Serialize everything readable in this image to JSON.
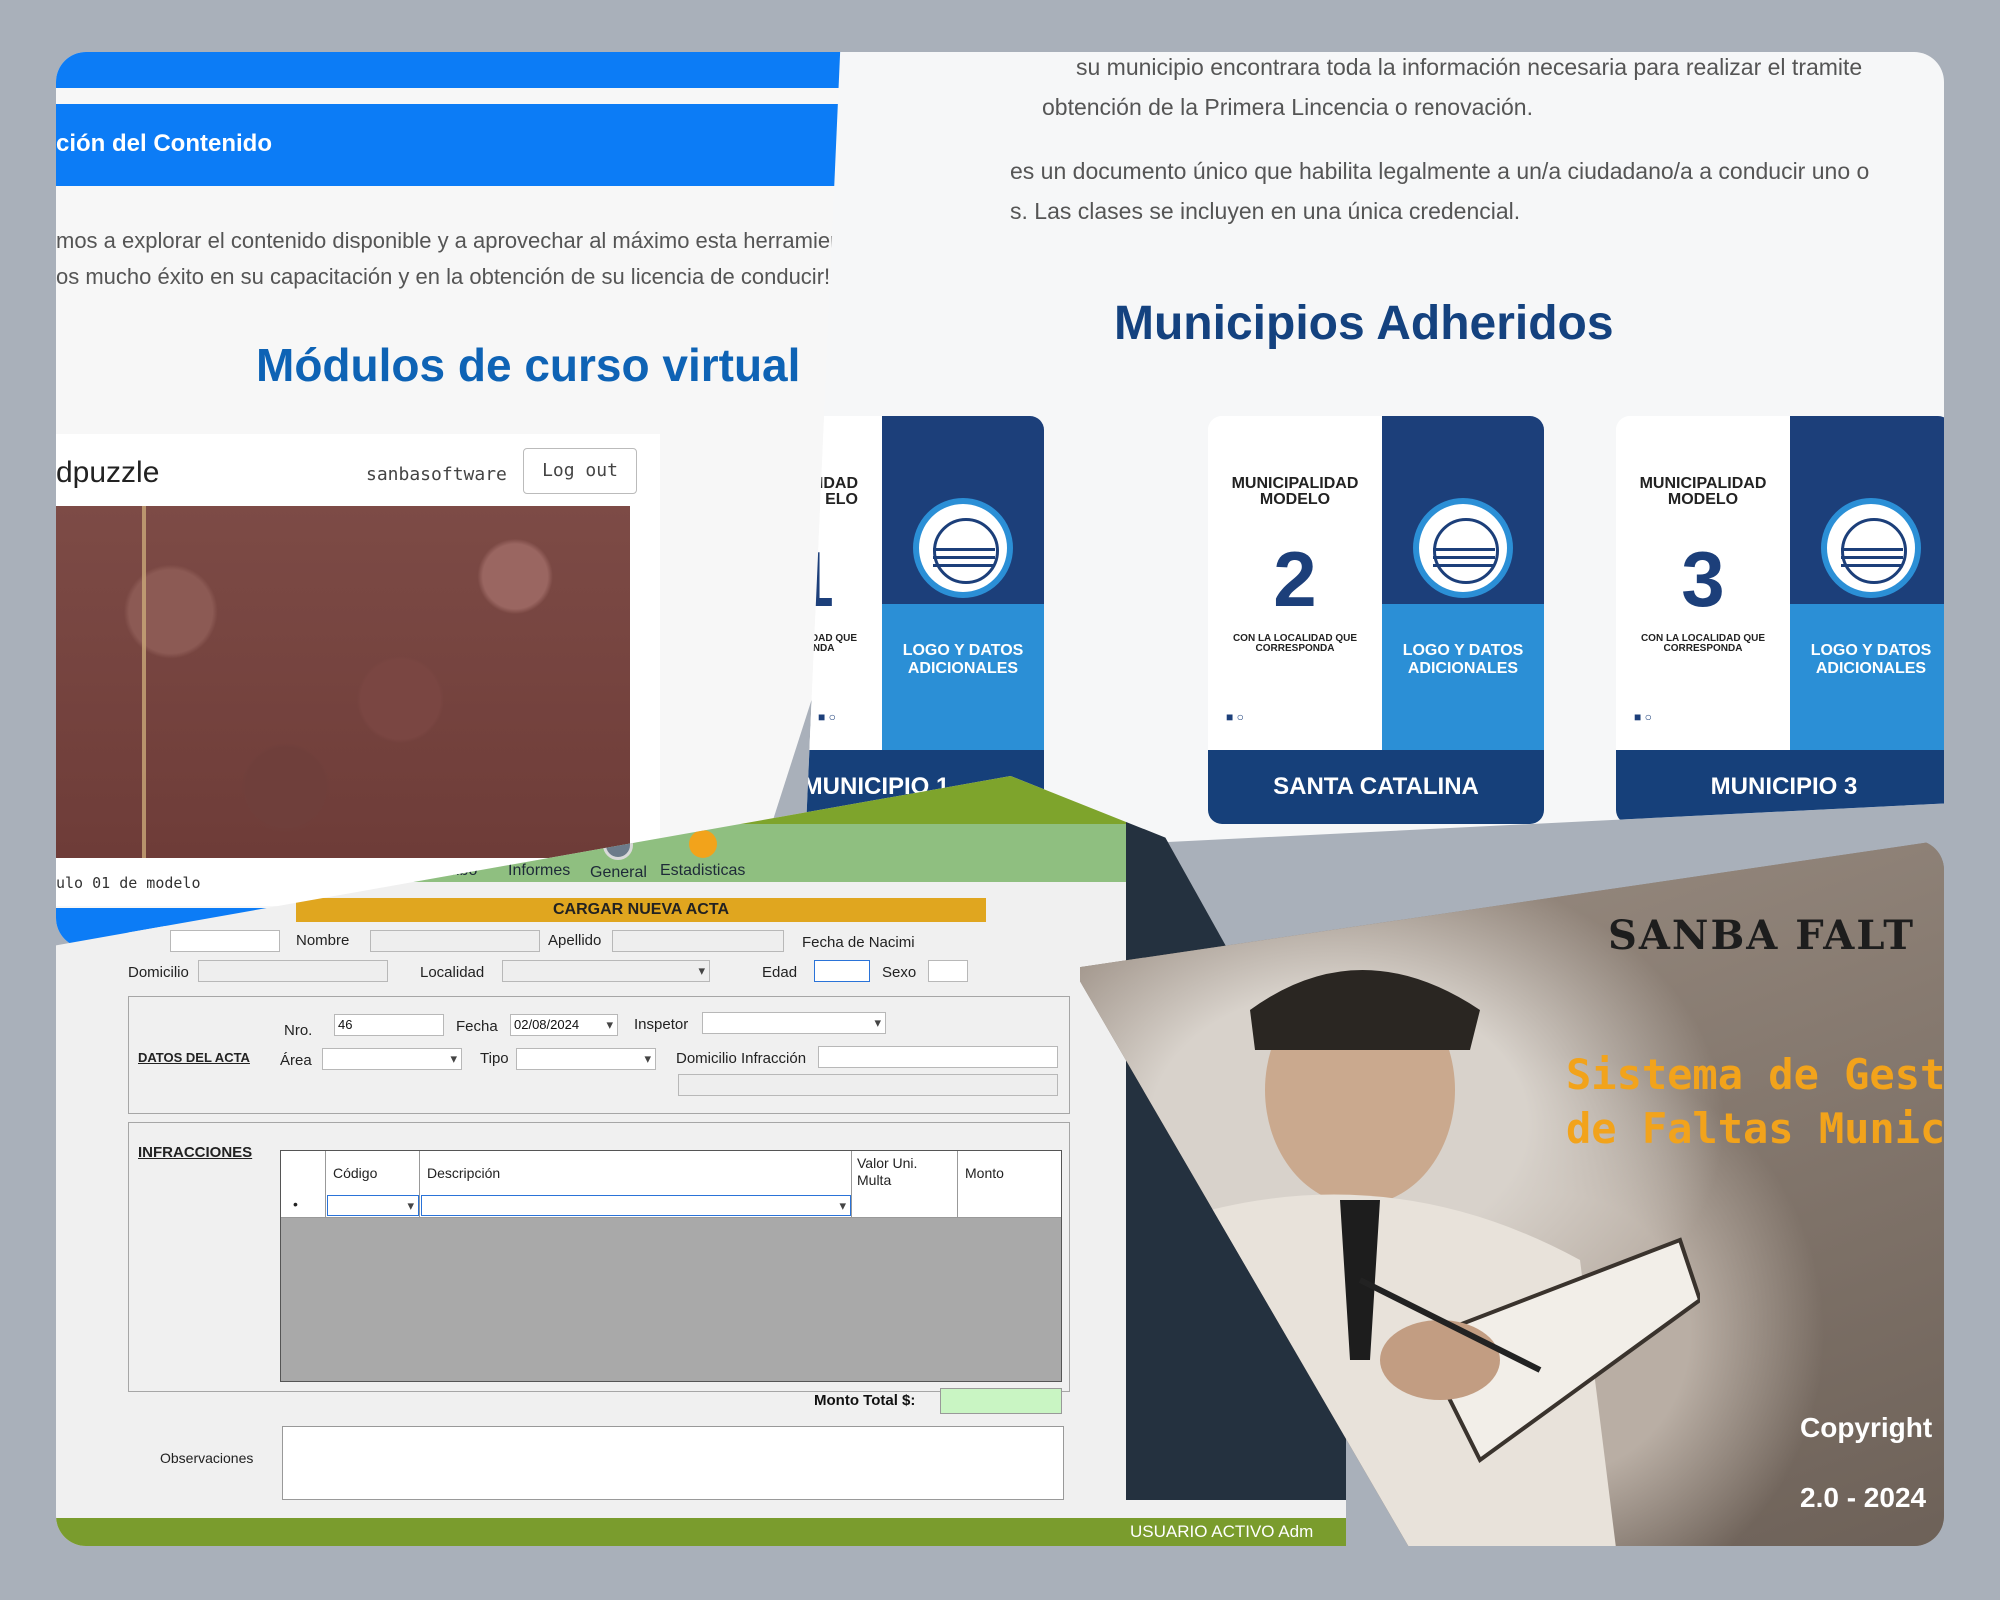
{
  "course": {
    "band_title": "ción del Contenido",
    "para1": "mos a explorar el contenido disponible y a aprovechar al máximo esta herramienta educ",
    "para2": "os mucho éxito en su capacitación y en la obtención de su licencia de conducir!",
    "heading": "Módulos de curso virtual",
    "embed": {
      "logo": "dpuzzle",
      "user": "sanbasoftware",
      "logout": "Log out",
      "module_label": "ulo 01 de modelo"
    }
  },
  "municipios": {
    "para1": "su municipio encontrara toda la información necesaria para realizar el tramite",
    "para2": "obtención de la Primera Lincencia o renovación.",
    "para3": "es un documento único que habilita legalmente a un/a ciudadano/a a conducir uno o",
    "para4": "s. Las clases se incluyen en una única credencial.",
    "heading": "Municipios Adheridos",
    "cards": [
      {
        "title": "ALIDAD\nELO",
        "number": "1",
        "subtitle": "CON LA LOCALIDAD QUE CORRESPONDA",
        "logo_text": "LOGO Y DATOS ADICIONALES",
        "name": "MUNICIPIO 1"
      },
      {
        "title": "MUNICIPALIDAD\nMODELO",
        "number": "2",
        "subtitle": "CON LA LOCALIDAD QUE CORRESPONDA",
        "logo_text": "LOGO Y DATOS ADICIONALES",
        "name": "SANTA CATALINA"
      },
      {
        "title": "MUNICIPALIDAD\nMODELO",
        "number": "3",
        "subtitle": "CON LA LOCALIDAD QUE CORRESPONDA",
        "logo_text": "LOGO Y DATOS ADICIONALES",
        "name": "MUNICIPIO 3"
      }
    ]
  },
  "form": {
    "header_fragment": "a",
    "toolbar": {
      "recibo": "cibo",
      "informes": "Informes",
      "general": "General",
      "estadisticas": "Estadisticas"
    },
    "cargar": "CARGAR NUEVA ACTA",
    "person": {
      "nombre": "Nombre",
      "apellido": "Apellido",
      "fecha_nac": "Fecha de Nacimi",
      "domicilio": "Domicilio",
      "localidad": "Localidad",
      "edad": "Edad",
      "sexo": "Sexo"
    },
    "acta": {
      "section": "DATOS DEL ACTA",
      "nro_label": "Nro.",
      "nro_value": "46",
      "fecha_label": "Fecha",
      "fecha_value": "02/08/2024",
      "inspector_label": "Inspetor",
      "area_label": "Área",
      "tipo_label": "Tipo",
      "domicilio_inf_label": "Domicilio Infracción"
    },
    "infracciones": {
      "section": "INFRACCIONES",
      "col_codigo": "Código",
      "col_descripcion": "Descripción",
      "col_valor": "Valor Uni.\nMulta",
      "col_monto": "Monto",
      "row_marker": "•"
    },
    "monto_total": "Monto Total $:",
    "observaciones": "Observaciones",
    "status": "USUARIO ACTIVO  Adm"
  },
  "splash": {
    "title": "SANBA FALT",
    "subtitle_line1": "Sistema de Gest",
    "subtitle_line2": "de Faltas Munici",
    "copyright": "Copyright",
    "version": "2.0 - 2024"
  },
  "colors": {
    "background": "#a9b0ba",
    "blue_band": "#0c7cf6",
    "heading_blue": "#0e63b5",
    "municipio_navy": "#16407a",
    "municipio_light": "#2b8fd6",
    "form_green": "#7a9c2d",
    "cargar_gold": "#e0a61f",
    "splash_orange": "#f2a31b"
  }
}
